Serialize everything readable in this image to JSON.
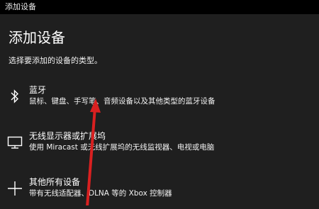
{
  "window": {
    "title": "添加设备"
  },
  "page": {
    "title": "添加设备",
    "subtitle": "选择要添加的设备的类型。"
  },
  "options": [
    {
      "label": "蓝牙",
      "description": "鼠标、键盘、手写笔、音频设备以及其他类型的蓝牙设备",
      "icon": "bluetooth-icon"
    },
    {
      "label": "无线显示器或扩展坞",
      "description": "使用 Miracast 或无线扩展坞的无线监视器、电视或电脑",
      "icon": "monitor-icon"
    },
    {
      "label": "其他所有设备",
      "description": "带有无线适配器、DLNA 等的 Xbox 控制器",
      "icon": "plus-icon"
    }
  ],
  "colors": {
    "background": "#1f1f1f",
    "titlebar": "#000000",
    "annotation_arrow": "#d92020"
  }
}
